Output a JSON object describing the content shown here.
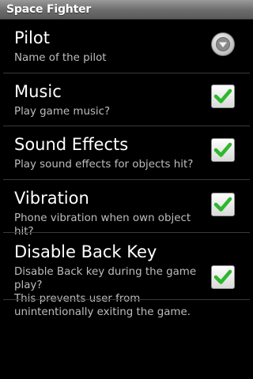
{
  "app": {
    "title": "Space Fighter"
  },
  "preferences": [
    {
      "title": "Pilot",
      "summary": "Name of the pilot",
      "control": "dropdown",
      "icon": "chevron-down-icon"
    },
    {
      "title": "Music",
      "summary": "Play game music?",
      "control": "checkbox",
      "checked": true
    },
    {
      "title": "Sound Effects",
      "summary": "Play sound effects for objects hit?",
      "control": "checkbox",
      "checked": true
    },
    {
      "title": "Vibration",
      "summary": "Phone vibration when own object hit?",
      "control": "checkbox",
      "checked": true
    },
    {
      "title": "Disable Back Key",
      "summary": "Disable Back key during the game play?\nThis prevents user from unintentionally exiting the game.",
      "summary_lines": [
        "Disable Back key during the game",
        "play?",
        "This prevents user from",
        "unintentionally exiting the game."
      ],
      "control": "checkbox",
      "checked": true
    }
  ],
  "colors": {
    "background": "#000000",
    "summary_text": "#bdbdbd",
    "check_green": "#2db82d",
    "divider": "#3a3a3a"
  }
}
